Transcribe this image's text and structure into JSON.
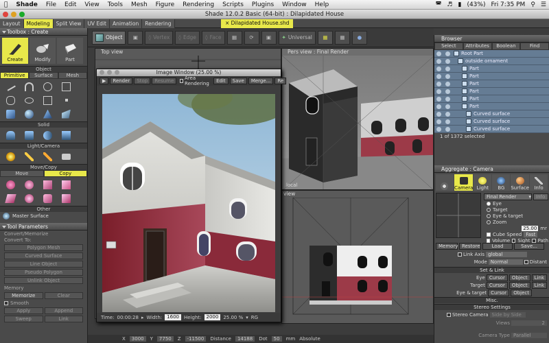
{
  "menubar": {
    "app": "Shade",
    "items": [
      "File",
      "Edit",
      "View",
      "Tools",
      "Mesh",
      "Figure",
      "Rendering",
      "Scripts",
      "Plugins",
      "Window",
      "Help"
    ],
    "battery": "(43%)",
    "clock": "Fri 7:35 PM"
  },
  "window": {
    "title": "Shade 12.0.2 Basic (64-bit) : Dilapidated House"
  },
  "tabs": [
    "Layout",
    "Modeling",
    "Split View",
    "UV Edit",
    "Animation",
    "Rendering"
  ],
  "active_tab": "Modeling",
  "doc_tab": "Dilapidated House.shd",
  "toolbar": {
    "object": "Object",
    "vertex": "Vertex",
    "edge": "Edge",
    "face": "Face",
    "universal": "Universal"
  },
  "toolbox": {
    "title": "Toolbox : Create",
    "create": "Create",
    "modify": "Modify",
    "part": "Part",
    "object": "Object",
    "primitive": "Primitive",
    "surface": "Surface",
    "mesh": "Mesh",
    "solid": "Solid",
    "light_camera": "Light/Camera",
    "move_copy": "Move/Copy",
    "move": "Move",
    "copy": "Copy",
    "other": "Other",
    "master_surface": "Master Surface"
  },
  "tool_params": {
    "title": "Tool Parameters",
    "convert_memorize": "Convert/Memorize",
    "convert_to": "Convert To:",
    "polygon_mesh": "Polygon Mesh",
    "curved_surface": "Curved Surface",
    "line_object": "Line Object",
    "pseudo_polygon": "Pseudo Polygon",
    "unlink_object": "Unlink Object",
    "memory": "Memory",
    "memorize": "Memorize",
    "clear": "Clear",
    "smooth": "Smooth",
    "apply": "Apply",
    "append": "Append",
    "sweep": "Sweep",
    "link": "Link"
  },
  "views": {
    "top": "Top view",
    "pers": "Pers view : Final Render",
    "front": "view",
    "local": "local"
  },
  "image_window": {
    "title": "Image Window (25.00 %)",
    "render": "Render",
    "stop": "Stop",
    "resume": "Resume",
    "area_rendering": "Area Rendering",
    "edit": "Edit",
    "save": "Save",
    "merge": "Merge...",
    "re": "Re",
    "time_label": "Time:",
    "time": "00:00:28",
    "width_label": "Width:",
    "width": "1600",
    "height_label": "Height:",
    "height": "2000",
    "zoom": "25.00 %",
    "rg": "RG"
  },
  "browser": {
    "title": "Browser",
    "select": "Select",
    "attributes": "Attributes",
    "boolean": "Boolean",
    "find": "Find",
    "items": [
      "Root Part",
      "outside ornament",
      "Part",
      "Part",
      "Part",
      "Part",
      "Part",
      "Part",
      "Curved surface",
      "Curved surface",
      "Curved surface"
    ],
    "status": "1 of 1372 selected"
  },
  "aggregate": {
    "title": "Aggregate : Camera",
    "camera": "Camera",
    "light": "Light",
    "bg": "BG",
    "surface": "Surface",
    "info": "Info",
    "final_render": "Final Render",
    "info_btn": "Info",
    "eye": "Eye",
    "target": "Target",
    "eye_target": "Eye & target",
    "zoom": "Zoom",
    "zoom_val": "25.00",
    "zoom_unit": "mr",
    "cube_speed": "Cube Speed",
    "cube_speed_val": "Fast",
    "volume": "Volume",
    "sight": "Sight",
    "path": "Path",
    "memory": "Memory",
    "restore": "Restore",
    "load": "Load",
    "save": "Save...",
    "link_axis": "Link Axis",
    "link_axis_val": "global",
    "mode": "Mode",
    "mode_val": "Normal",
    "distant": "Distant",
    "set_link": "Set & Link",
    "eye_row": "Eye",
    "target_row": "Target",
    "eye_target_row": "Eye & target",
    "cursor": "Cursor",
    "object": "Object",
    "link": "Link",
    "misc": "Misc.",
    "stereo_settings": "Stereo Settings",
    "stereo_camera": "Stereo Camera",
    "side_by_side": "Side by Side",
    "views": "Views",
    "views_val": "2",
    "camera_type": "Camera Type",
    "parallel": "Parallel"
  },
  "status": {
    "x_label": "X",
    "x": "3000",
    "y_label": "Y",
    "y": "7750",
    "z_label": "Z",
    "z": "-11500",
    "dist_label": "Distance",
    "dist": "14188",
    "dot_label": "Dot",
    "dot": "50",
    "unit": "mm",
    "absolute": "Absolute"
  },
  "colors": {
    "accent": "#e8e84a",
    "tree": "#657c94"
  }
}
